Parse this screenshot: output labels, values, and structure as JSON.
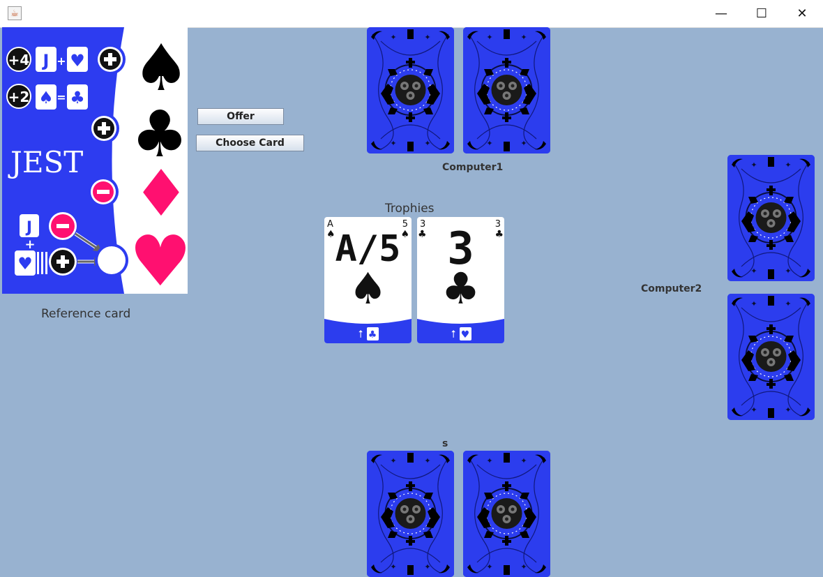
{
  "window": {
    "app_icon": "java-cup-icon",
    "minimize_label": "—",
    "maximize_label": "☐",
    "close_label": "✕"
  },
  "reference_card": {
    "label": "Reference card",
    "logo_text": "JEST",
    "rules": [
      {
        "badge": "+4",
        "text": "J+♥"
      },
      {
        "badge": "+2",
        "text": "♠=♣"
      }
    ]
  },
  "buttons": {
    "offer": "Offer",
    "choose_card": "Choose Card"
  },
  "players": {
    "top": "Computer1",
    "right": "Computer2",
    "bottom": "s"
  },
  "trophies": {
    "label": "Trophies",
    "cards": [
      {
        "rank_left": "A",
        "rank_right": "5",
        "big_rank": "A/5",
        "suit": "♠",
        "trophy_condition": "⭡🂠♣"
      },
      {
        "rank_left": "3",
        "rank_right": "3",
        "big_rank": "3",
        "suit": "♣",
        "trophy_condition": "⭡♥"
      }
    ]
  },
  "colors": {
    "table": "#98b2d0",
    "card_back": "#2c3dee",
    "accent_pink": "#ff1070"
  }
}
